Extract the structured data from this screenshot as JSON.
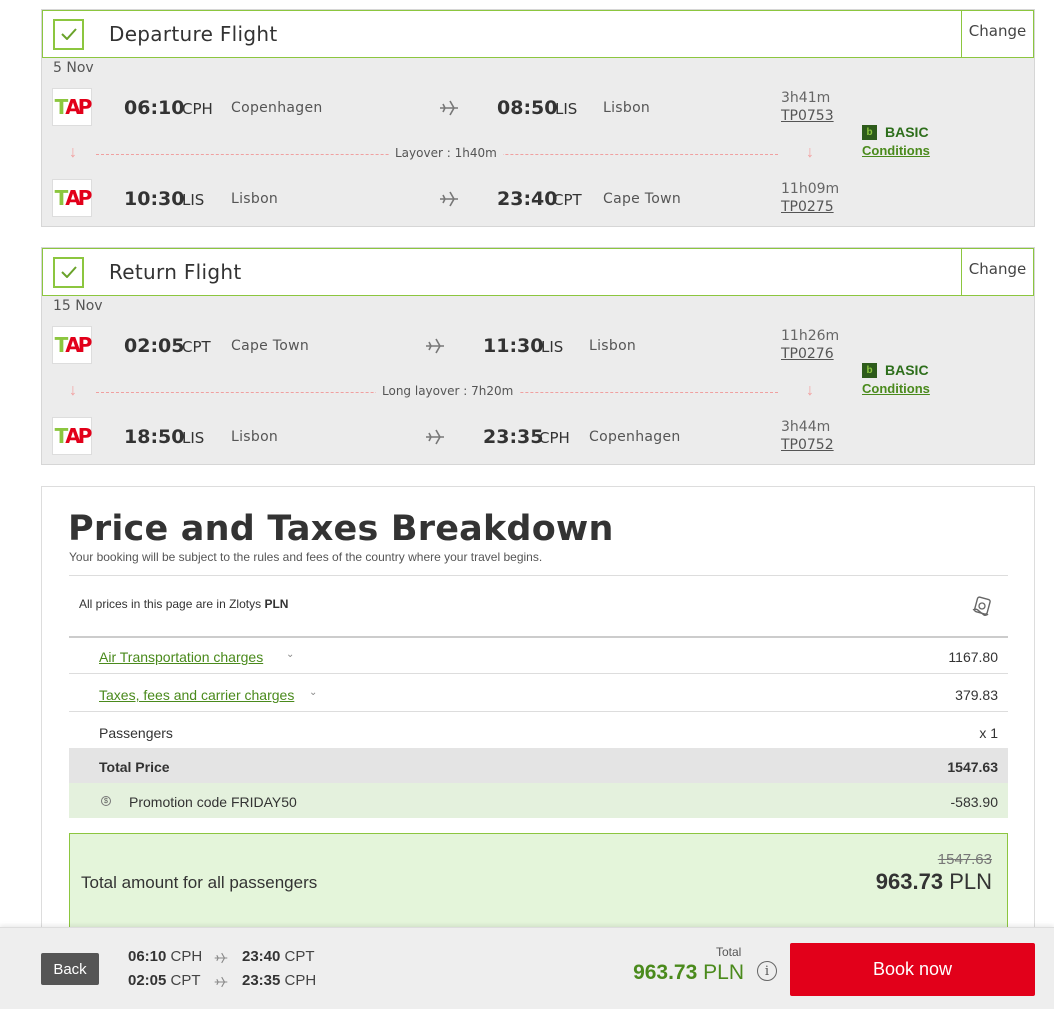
{
  "departure": {
    "title": "Departure Flight",
    "change_label": "Change",
    "date": "5 Nov",
    "segments": [
      {
        "dep_time": "06:10",
        "dep_code": "CPH",
        "dep_city": "Copenhagen",
        "arr_time": "08:50",
        "arr_code": "LIS",
        "arr_city": "Lisbon",
        "duration": "3h41m",
        "flight_no": "TP0753"
      },
      {
        "dep_time": "10:30",
        "dep_code": "LIS",
        "dep_city": "Lisbon",
        "arr_time": "23:40",
        "arr_code": "CPT",
        "arr_city": "Cape Town",
        "duration": "11h09m",
        "flight_no": "TP0275"
      }
    ],
    "layover": "Layover : 1h40m",
    "fare_name": "BASIC",
    "conditions_label": "Conditions"
  },
  "return": {
    "title": "Return Flight",
    "change_label": "Change",
    "date": "15 Nov",
    "segments": [
      {
        "dep_time": "02:05",
        "dep_code": "CPT",
        "dep_city": "Cape Town",
        "arr_time": "11:30",
        "arr_code": "LIS",
        "arr_city": "Lisbon",
        "duration": "11h26m",
        "flight_no": "TP0276"
      },
      {
        "dep_time": "18:50",
        "dep_code": "LIS",
        "dep_city": "Lisbon",
        "arr_time": "23:35",
        "arr_code": "CPH",
        "arr_city": "Copenhagen",
        "duration": "3h44m",
        "flight_no": "TP0752"
      }
    ],
    "layover": "Long layover : 7h20m",
    "fare_name": "BASIC",
    "conditions_label": "Conditions"
  },
  "price": {
    "title": "Price and Taxes Breakdown",
    "subtitle": "Your booking will be subject to the rules and fees of the country where your travel begins.",
    "currency_prefix": "All prices in this page are in Zlotys",
    "currency_code": "PLN",
    "rows": [
      {
        "label": "Air Transportation charges",
        "value": "1167.80"
      },
      {
        "label": "Taxes, fees and carrier charges",
        "value": "379.83"
      },
      {
        "label": "Passengers",
        "value": "x 1"
      }
    ],
    "total_label": "Total Price",
    "total_value": "1547.63",
    "promo_label": "Promotion code FRIDAY50",
    "promo_value": "-583.90",
    "total_all_label": "Total amount for all passengers",
    "old_total": "1547.63",
    "new_total": "963.73",
    "currency": "PLN"
  },
  "bottom": {
    "back_label": "Back",
    "out_dep_time": "06:10",
    "out_dep_code": "CPH",
    "out_arr_time": "23:40",
    "out_arr_code": "CPT",
    "ret_dep_time": "02:05",
    "ret_dep_code": "CPT",
    "ret_arr_time": "23:35",
    "ret_arr_code": "CPH",
    "total_label": "Total",
    "total_value": "963.73",
    "currency": "PLN",
    "book_label": "Book now"
  },
  "colors": {
    "accent_green": "#8cc63f",
    "link_green": "#4a8a1c",
    "brand_red": "#e2001a"
  }
}
